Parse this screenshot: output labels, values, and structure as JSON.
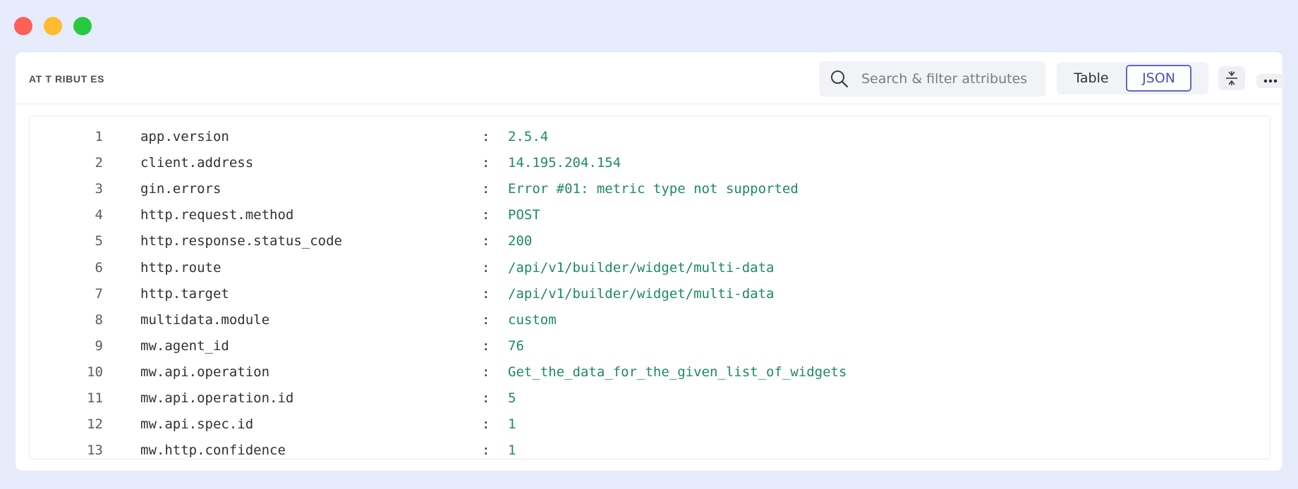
{
  "panel": {
    "title": "AT T RIBUT ES",
    "search": {
      "placeholder": "Search & filter attributes",
      "value": ""
    },
    "view_toggle": {
      "options": [
        "Table",
        "JSON"
      ],
      "selected": "JSON"
    },
    "icons": {
      "search": "search-icon",
      "collapse": "collapse-icon",
      "more": "more-icon"
    }
  },
  "attributes": [
    {
      "line": "1",
      "key": "app.version",
      "value": "2.5.4"
    },
    {
      "line": "2",
      "key": "client.address",
      "value": "14.195.204.154"
    },
    {
      "line": "3",
      "key": "gin.errors",
      "value": "Error #01: metric type not supported"
    },
    {
      "line": "4",
      "key": "http.request.method",
      "value": "POST"
    },
    {
      "line": "5",
      "key": "http.response.status_code",
      "value": "200"
    },
    {
      "line": "6",
      "key": "http.route",
      "value": "/api/v1/builder/widget/multi-data"
    },
    {
      "line": "7",
      "key": "http.target",
      "value": "/api/v1/builder/widget/multi-data"
    },
    {
      "line": "8",
      "key": "multidata.module",
      "value": "custom"
    },
    {
      "line": "9",
      "key": "mw.agent_id",
      "value": "76"
    },
    {
      "line": "10",
      "key": "mw.api.operation",
      "value": "Get_the_data_for_the_given_list_of_widgets"
    },
    {
      "line": "11",
      "key": "mw.api.operation.id",
      "value": "5"
    },
    {
      "line": "12",
      "key": "mw.api.spec.id",
      "value": "1"
    },
    {
      "line": "13",
      "key": "mw.http.confidence",
      "value": "1"
    }
  ],
  "separator": ":",
  "colors": {
    "value": "#1c8a64",
    "accent": "#6266c8",
    "background": "#e6ecfb"
  }
}
